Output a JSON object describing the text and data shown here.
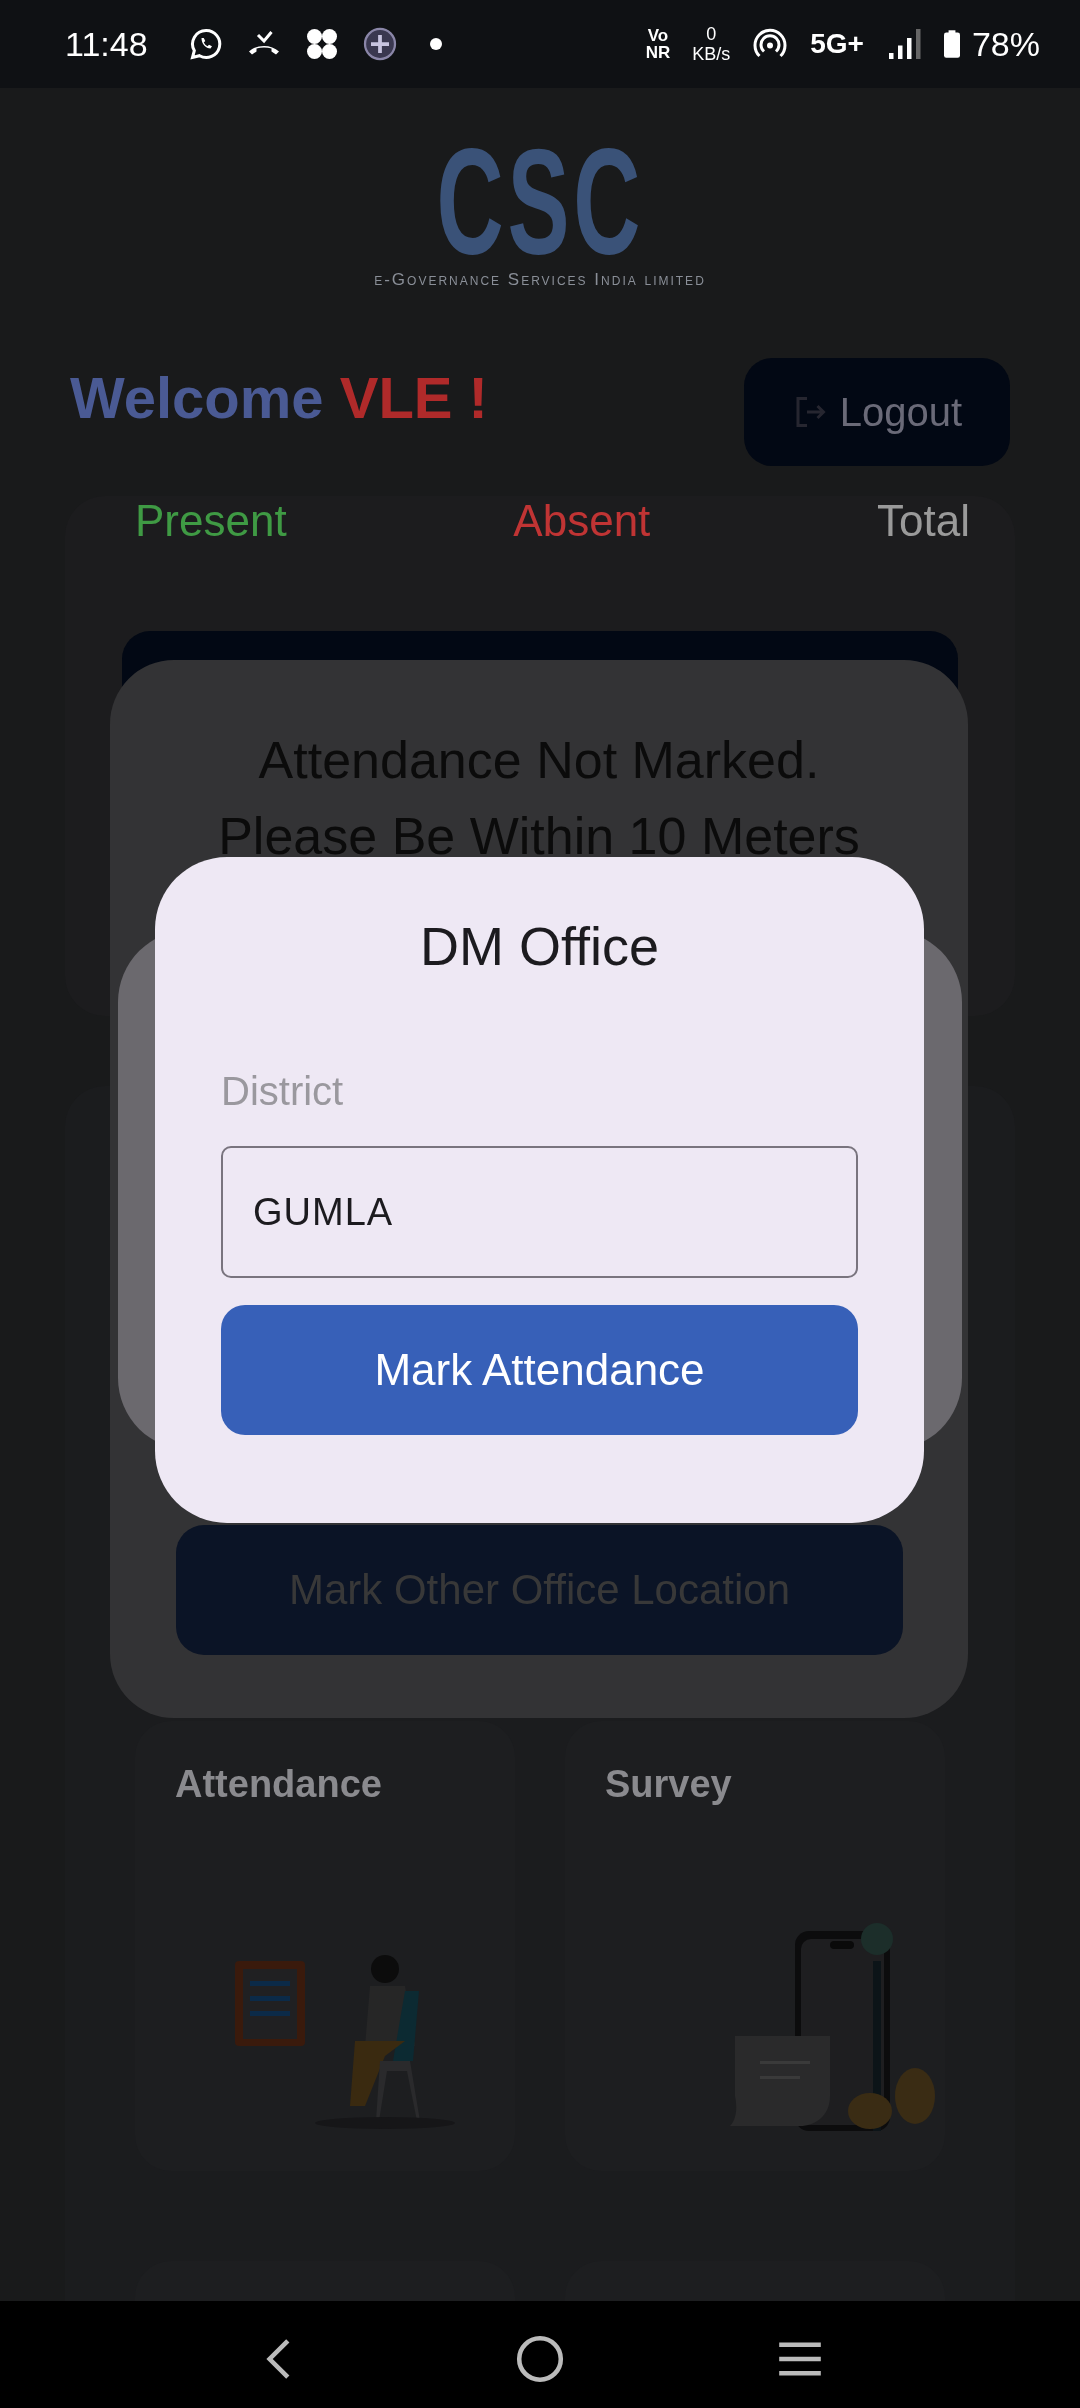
{
  "status_bar": {
    "time": "11:48",
    "vo": "Vo",
    "nr": "NR",
    "speed_value": "0",
    "speed_unit": "KB/s",
    "network": "5G+",
    "battery": "78%"
  },
  "header": {
    "logo": "CSC",
    "logo_subtitle": "e-Governance Services India limited",
    "welcome": "Welcome",
    "user": "VLE !",
    "logout": "Logout"
  },
  "stats": [
    {
      "label": "Present",
      "color": "#3f9a44"
    },
    {
      "label": "Absent",
      "color": "#c03434"
    },
    {
      "label": "Total",
      "color": "#9a9a9a"
    }
  ],
  "alert_dialog": {
    "message_lines": [
      "Attendance Not Marked.",
      "Please Be Within 10 Meters"
    ],
    "other_button": "Mark Other Office Location"
  },
  "office_dialog": {
    "title": "DM Office",
    "field_label": "District",
    "field_value": "GUMLA",
    "button": "Mark Attendance"
  },
  "tiles": [
    {
      "title": "Attendance",
      "kind": "attendance"
    },
    {
      "title": "Survey",
      "kind": "survey"
    }
  ]
}
